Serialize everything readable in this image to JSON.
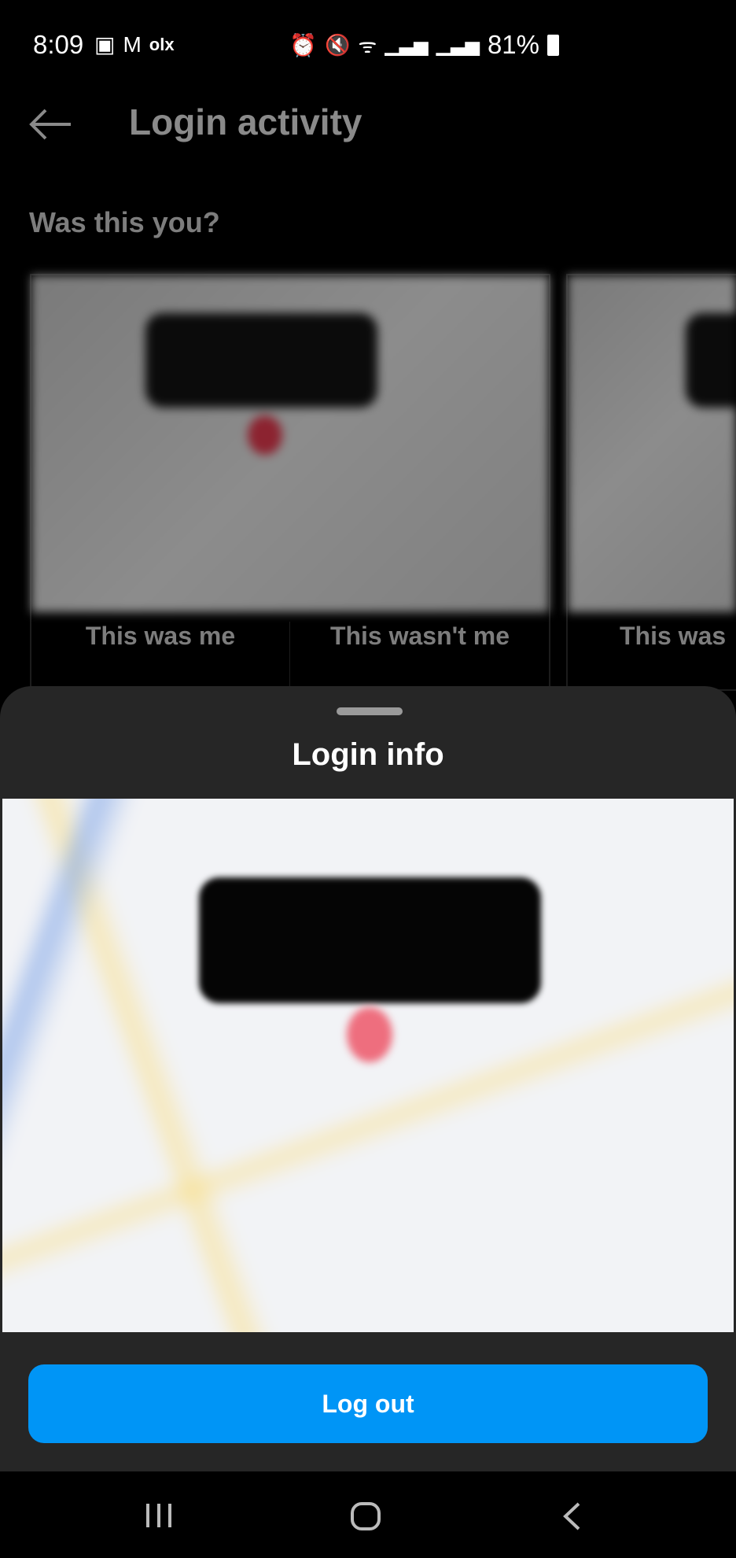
{
  "status_bar": {
    "time": "8:09",
    "battery": "81%",
    "left_icons": [
      "gallery-icon",
      "gmail-icon",
      "olx-icon"
    ],
    "right_icons": [
      "alarm-icon",
      "mute-icon",
      "wifi-icon",
      "signal-icon",
      "signal-icon",
      "battery-icon"
    ]
  },
  "header": {
    "title": "Login activity"
  },
  "section": {
    "title": "Was this you?"
  },
  "cards": [
    {
      "confirm": "This was me",
      "deny": "This wasn't me"
    },
    {
      "confirm": "This was"
    }
  ],
  "sheet": {
    "title": "Login info",
    "logout_label": "Log out"
  },
  "colors": {
    "accent": "#0095f6",
    "sheet_bg": "#262626"
  }
}
